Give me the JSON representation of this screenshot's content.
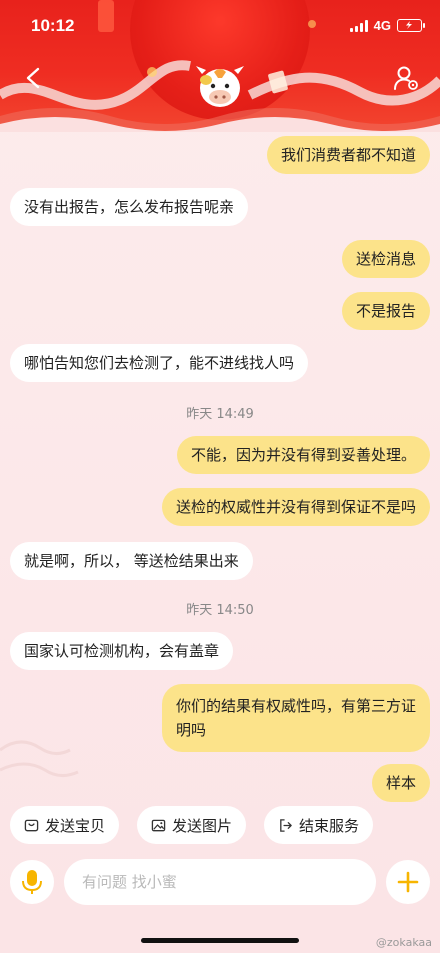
{
  "status_bar": {
    "time": "10:12",
    "network": "4G"
  },
  "header": {
    "back_icon": "chevron-left-icon",
    "profile_icon": "user-settings-icon",
    "avatar_icon": "cow-mascot-icon"
  },
  "messages": [
    {
      "side": "right",
      "text": "我们消费者都不知道"
    },
    {
      "side": "left",
      "text": "没有出报告，怎么发布报告呢亲"
    },
    {
      "side": "right",
      "text": "送检消息"
    },
    {
      "side": "right",
      "text": "不是报告"
    },
    {
      "side": "left",
      "text": "哪怕告知您们去检测了，能不进线找人吗"
    },
    {
      "side": "right",
      "text": "不能，因为并没有得到妥善处理。"
    },
    {
      "side": "right",
      "text": "送检的权威性并没有得到保证不是吗"
    },
    {
      "side": "left",
      "text": "就是啊，所以，  等送检结果出来"
    },
    {
      "side": "left",
      "text": "国家认可检测机构，会有盖章"
    },
    {
      "side": "right",
      "text_line1": "你们的结果有权威性吗，有第三方证",
      "text_line2": "明吗"
    },
    {
      "side": "right",
      "text": "样本"
    }
  ],
  "timestamps": [
    "昨天 14:49",
    "昨天 14:50"
  ],
  "quick_actions": [
    {
      "label": "发送宝贝",
      "icon": "package-icon"
    },
    {
      "label": "发送图片",
      "icon": "image-icon"
    },
    {
      "label": "结束服务",
      "icon": "exit-icon"
    }
  ],
  "input": {
    "placeholder": "有问题 找小蜜"
  },
  "watermark": "@zokakaa",
  "colors": {
    "header_red": "#e8221c",
    "bubble_right": "#fce38a",
    "bubble_left": "#ffffff",
    "accent": "#f7b500"
  }
}
